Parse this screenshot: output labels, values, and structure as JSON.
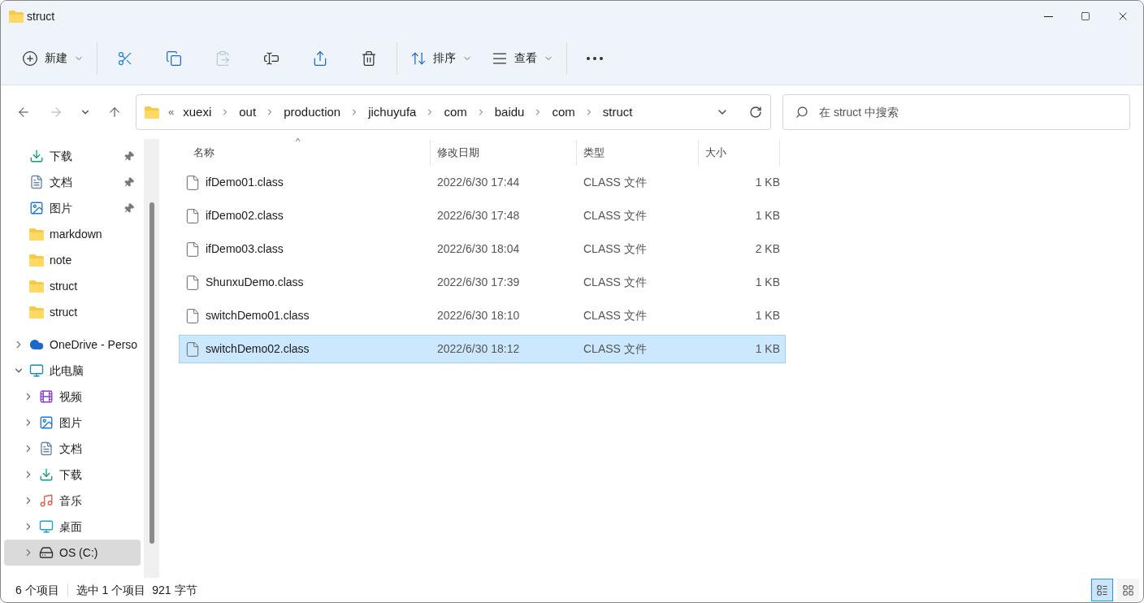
{
  "window": {
    "title": "struct"
  },
  "toolbar": [
    {
      "kind": "new",
      "label": "新建",
      "disabled": false
    },
    {
      "kind": "cut",
      "disabled": false
    },
    {
      "kind": "copy",
      "disabled": false
    },
    {
      "kind": "paste",
      "disabled": true
    },
    {
      "kind": "rename",
      "disabled": false
    },
    {
      "kind": "share",
      "disabled": false
    },
    {
      "kind": "delete",
      "disabled": false
    },
    {
      "kind": "sort",
      "label": "排序",
      "disabled": false
    },
    {
      "kind": "view",
      "label": "查看",
      "disabled": false
    },
    {
      "kind": "more",
      "disabled": false
    }
  ],
  "address": {
    "overflow": "«",
    "crumbs": [
      "xuexi",
      "out",
      "production",
      "jichuyufa",
      "com",
      "baidu",
      "com",
      "struct"
    ]
  },
  "search": {
    "placeholder": "在 struct 中搜索"
  },
  "sidebar": {
    "items": [
      {
        "label": "下载",
        "kind": "download",
        "pinned": true,
        "selected": false
      },
      {
        "label": "文档",
        "kind": "documents",
        "pinned": true,
        "selected": false
      },
      {
        "label": "图片",
        "kind": "pictures",
        "pinned": true,
        "selected": false
      },
      {
        "label": "markdown",
        "kind": "folder",
        "pinned": false,
        "selected": false
      },
      {
        "label": "note",
        "kind": "folder",
        "pinned": false,
        "selected": false
      },
      {
        "label": "struct",
        "kind": "folder",
        "pinned": false,
        "selected": false
      },
      {
        "label": "struct",
        "kind": "folder",
        "pinned": false,
        "selected": false
      },
      {
        "label": "OneDrive - Perso",
        "kind": "onedrive",
        "expanded": false,
        "selected": false
      },
      {
        "label": "此电脑",
        "kind": "pc",
        "expanded": true,
        "selected": false,
        "children": [
          {
            "label": "视频",
            "kind": "videos",
            "expanded": false,
            "selected": false
          },
          {
            "label": "图片",
            "kind": "pictures",
            "expanded": false,
            "selected": false
          },
          {
            "label": "文档",
            "kind": "documents",
            "expanded": false,
            "selected": false
          },
          {
            "label": "下载",
            "kind": "download",
            "expanded": false,
            "selected": false
          },
          {
            "label": "音乐",
            "kind": "music",
            "expanded": false,
            "selected": false
          },
          {
            "label": "桌面",
            "kind": "desktop",
            "expanded": false,
            "selected": false
          },
          {
            "label": "OS (C:)",
            "kind": "drive",
            "expanded": false,
            "selected": true
          }
        ]
      }
    ]
  },
  "table": {
    "sort_mark": "^",
    "columns": [
      "名称",
      "修改日期",
      "类型",
      "大小"
    ],
    "rows": [
      {
        "name": "ifDemo01.class",
        "modified": "2022/6/30 17:44",
        "type": "CLASS 文件",
        "size": "1 KB",
        "selected": false
      },
      {
        "name": "ifDemo02.class",
        "modified": "2022/6/30 17:48",
        "type": "CLASS 文件",
        "size": "1 KB",
        "selected": false
      },
      {
        "name": "ifDemo03.class",
        "modified": "2022/6/30 18:04",
        "type": "CLASS 文件",
        "size": "2 KB",
        "selected": false
      },
      {
        "name": "ShunxuDemo.class",
        "modified": "2022/6/30 17:39",
        "type": "CLASS 文件",
        "size": "1 KB",
        "selected": false
      },
      {
        "name": "switchDemo01.class",
        "modified": "2022/6/30 18:10",
        "type": "CLASS 文件",
        "size": "1 KB",
        "selected": false
      },
      {
        "name": "switchDemo02.class",
        "modified": "2022/6/30 18:12",
        "type": "CLASS 文件",
        "size": "1 KB",
        "selected": true
      }
    ]
  },
  "status_bar": {
    "count": "6 个项目",
    "selection": "选中 1 个项目",
    "size": "921 字节",
    "views": [
      {
        "kind": "details",
        "selected": true
      },
      {
        "kind": "tiles",
        "selected": false
      }
    ]
  }
}
